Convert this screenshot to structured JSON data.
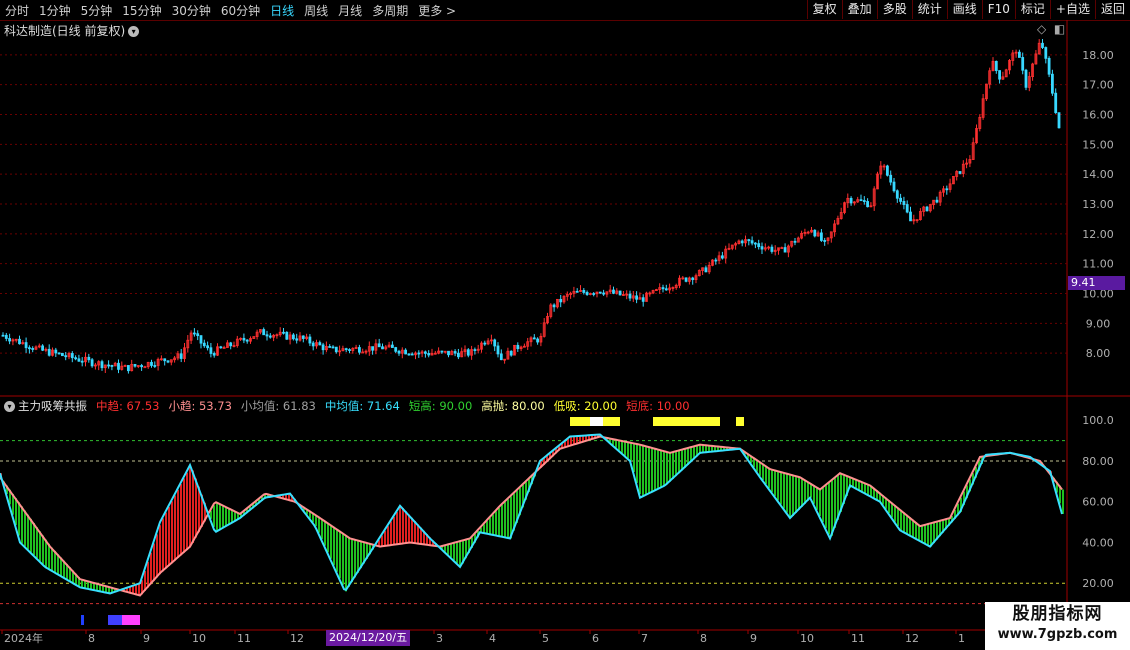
{
  "toolbar": {
    "periods": [
      "分时",
      "1分钟",
      "5分钟",
      "15分钟",
      "30分钟",
      "60分钟",
      "日线",
      "周线",
      "月线",
      "多周期",
      "更多 >"
    ],
    "active_period": "日线",
    "right_buttons": [
      "复权",
      "叠加",
      "多股",
      "统计",
      "画线",
      "F10",
      "标记",
      "+自选",
      "返回"
    ]
  },
  "main_panel": {
    "title": "科达制造(日线 前复权)",
    "price_axis": [
      "18.00",
      "17.00",
      "16.00",
      "15.00",
      "14.00",
      "13.00",
      "12.00",
      "11.00",
      "10.00",
      "9.00",
      "8.00"
    ],
    "current_price_tag": "9.41"
  },
  "indicator_panel": {
    "name": "主力吸筹共振",
    "legend": [
      {
        "label": "中趋:",
        "value": "67.53",
        "color": "#ff3030"
      },
      {
        "label": "小趋:",
        "value": "53.73",
        "color": "#ff9090"
      },
      {
        "label": "小均值:",
        "value": "61.83",
        "color": "#a0a0a0"
      },
      {
        "label": "中均值:",
        "value": "71.64",
        "color": "#38e0ff"
      },
      {
        "label": "短高:",
        "value": "90.00",
        "color": "#30d030"
      },
      {
        "label": "高抛:",
        "value": "80.00",
        "color": "#ffffa0"
      },
      {
        "label": "低吸:",
        "value": "20.00",
        "color": "#ffff30"
      },
      {
        "label": "短底:",
        "value": "10.00",
        "color": "#ff3030"
      }
    ],
    "axis": [
      "100.0",
      "80.00",
      "60.00",
      "40.00",
      "20.00"
    ]
  },
  "time_axis": [
    "2024年",
    "8",
    "9",
    "10",
    "11",
    "12",
    "2024/12/20/五",
    "3",
    "4",
    "5",
    "6",
    "7",
    "8",
    "9",
    "10",
    "11",
    "12",
    "1"
  ],
  "cursor_date": "2024/12/20/五",
  "watermark": {
    "line1": "股朋指标网",
    "line2": "www.7gpzb.com"
  },
  "colors": {
    "up": "#ff3030",
    "down": "#38d8ff",
    "grid": "#8a0000",
    "accent": "#38d8ff"
  }
}
